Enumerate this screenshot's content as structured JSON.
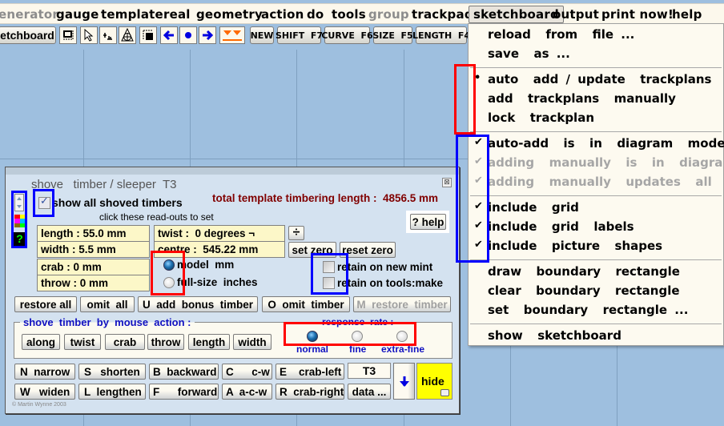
{
  "menubar": {
    "items": [
      {
        "label": "generator",
        "disabled": true,
        "partial": "enerator"
      },
      {
        "label": "gauge"
      },
      {
        "label": "template"
      },
      {
        "label": "real"
      },
      {
        "label": "geometry"
      },
      {
        "label": "action"
      },
      {
        "label": "do"
      },
      {
        "label": "tools"
      },
      {
        "label": "group",
        "disabled": true
      },
      {
        "label": "trackpad"
      },
      {
        "label": "sketchboard",
        "selected": true
      },
      {
        "label": "output"
      },
      {
        "label": "print now!"
      },
      {
        "label": "help"
      }
    ]
  },
  "toolbar": {
    "sketchboard_partial": "etchboard",
    "icons": [
      "select-rectangle-icon",
      "pointer-icon",
      "align-icon",
      "circle-cross-icon",
      "fill-rect-icon",
      "arrow-left-icon",
      "dot-icon",
      "arrow-right-icon",
      "double-down-icon"
    ],
    "buttons": [
      "NEW",
      "SHIFT  F7",
      "CURVE  F6",
      "SIZE  F5",
      "LENGTH  F4"
    ]
  },
  "sketchboard_menu": {
    "group1": [
      "reload  from  file ...",
      "save  as ..."
    ],
    "group2": [
      {
        "label": "auto  add / update  trackplans",
        "mark": "•"
      },
      {
        "label": "add  trackplans  manually",
        "mark": ""
      },
      {
        "label": "lock  trackplan",
        "mark": ""
      }
    ],
    "group3": [
      {
        "label": "auto-add  is  in  diagram  mode",
        "mark": "✔",
        "disabled": false
      },
      {
        "label": "adding  manually  is  in  diagram  mode",
        "mark": "✔",
        "disabled": true
      },
      {
        "label": "adding  manually  updates  all  items",
        "mark": "✔",
        "disabled": true
      }
    ],
    "group4": [
      {
        "label": "include  grid",
        "mark": "✔"
      },
      {
        "label": "include  grid  labels",
        "mark": "✔"
      },
      {
        "label": "include  picture  shapes",
        "mark": "✔"
      }
    ],
    "group5": [
      "draw  boundary  rectangle",
      "clear  boundary  rectangle",
      "set  boundary  rectangle ..."
    ],
    "group6": [
      "show  sketchboard"
    ]
  },
  "dialog": {
    "title": "shove   timber / sleeper  T3",
    "show_all_label": "show all shoved timbers",
    "show_all_checked": true,
    "total_label": "total template timbering length :  4856.5 mm",
    "click_hint": "click these read-outs to set",
    "help_button": "? help",
    "readouts": {
      "length": "length :  55.0 mm",
      "width": "width :  5.5 mm",
      "twist": "twist :  0 degrees ¬",
      "centre": "centre :  545.22 mm",
      "crab": "crab :  0 mm",
      "throw": "throw :  0 mm"
    },
    "divide_button": "÷",
    "set_zero": "set zero",
    "reset_zero": "reset zero",
    "units": [
      {
        "label": "model  mm",
        "selected": true
      },
      {
        "label": "full-size  inches",
        "selected": false
      }
    ],
    "retain": [
      {
        "label": "retain on new mint",
        "checked": false
      },
      {
        "label": "retain on tools:make",
        "checked": false
      }
    ],
    "row_buttons": [
      "restore all",
      "omit  all",
      "U  add  bonus  timber",
      "O  omit  timber",
      "M  restore  timber"
    ],
    "mouse_group_label": "shove  timber  by  mouse  action :",
    "mouse_buttons": [
      "along",
      "twist",
      "crab",
      "throw",
      "length",
      "width"
    ],
    "response_label": "response  rate :",
    "response_rates": [
      {
        "label": "normal",
        "selected": true
      },
      {
        "label": "fine",
        "selected": false
      },
      {
        "label": "extra-fine",
        "selected": false
      }
    ],
    "key_buttons_row1": [
      "N  narrow",
      "S   shorten",
      "B  backward",
      "C      c-w",
      "E    crab-left"
    ],
    "key_buttons_row2": [
      "W   widen",
      "L  lengthen",
      "F      forward",
      "A  a-c-w",
      "R  crab-right"
    ],
    "timber_id": "T3",
    "data_button": "data ...",
    "hide_button": "hide",
    "copyright": "© Martin Wynne  2003"
  },
  "colors": {
    "canvas": "#9ebfdf",
    "dialog_bg": "#d4e2f0",
    "readout_bg": "#fcf7c8",
    "total_text": "#800000",
    "group_label": "#1010c0",
    "hide_bg": "#ffff00",
    "annotation_red": "#ff0000",
    "annotation_blue": "#0000ff"
  }
}
